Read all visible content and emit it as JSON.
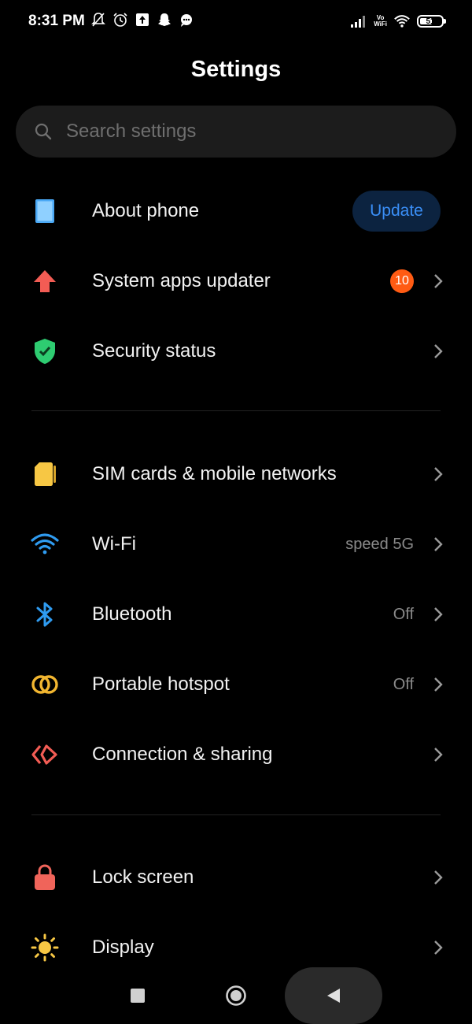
{
  "status_bar": {
    "time": "8:31 PM",
    "left_icons": [
      "muted-bell-icon",
      "alarm-icon",
      "upload-icon",
      "snapchat-icon",
      "chat-icon"
    ],
    "network_label_top": "Vo",
    "network_label_bottom": "WiFi",
    "battery_level": "51"
  },
  "header": {
    "title": "Settings"
  },
  "search": {
    "placeholder": "Search settings"
  },
  "sections": [
    {
      "items": [
        {
          "icon": "phone-icon",
          "label": "About phone",
          "action_label": "Update"
        },
        {
          "icon": "arrow-up-icon",
          "label": "System apps updater",
          "badge": "10"
        },
        {
          "icon": "shield-icon",
          "label": "Security status"
        }
      ]
    },
    {
      "items": [
        {
          "icon": "sim-card-icon",
          "label": "SIM cards & mobile networks"
        },
        {
          "icon": "wifi-icon",
          "label": "Wi-Fi",
          "value": "speed 5G"
        },
        {
          "icon": "bluetooth-icon",
          "label": "Bluetooth",
          "value": "Off"
        },
        {
          "icon": "hotspot-icon",
          "label": "Portable hotspot",
          "value": "Off"
        },
        {
          "icon": "connection-sharing-icon",
          "label": "Connection & sharing"
        }
      ]
    },
    {
      "items": [
        {
          "icon": "lock-icon",
          "label": "Lock screen"
        },
        {
          "icon": "sun-icon",
          "label": "Display"
        }
      ]
    }
  ],
  "colors": {
    "background": "#000000",
    "accent_blue": "#3a8ef6",
    "badge_orange": "#ff5b13",
    "shield_green": "#2ecc71",
    "sim_yellow": "#f7c744",
    "wifi_blue": "#2f9bf0",
    "hotspot_yellow": "#f2b630",
    "share_red": "#f25c54",
    "lock_red": "#f0645a",
    "arrow_red": "#f25c54"
  },
  "nav_bar": {
    "buttons": [
      "recents",
      "home",
      "back"
    ]
  }
}
